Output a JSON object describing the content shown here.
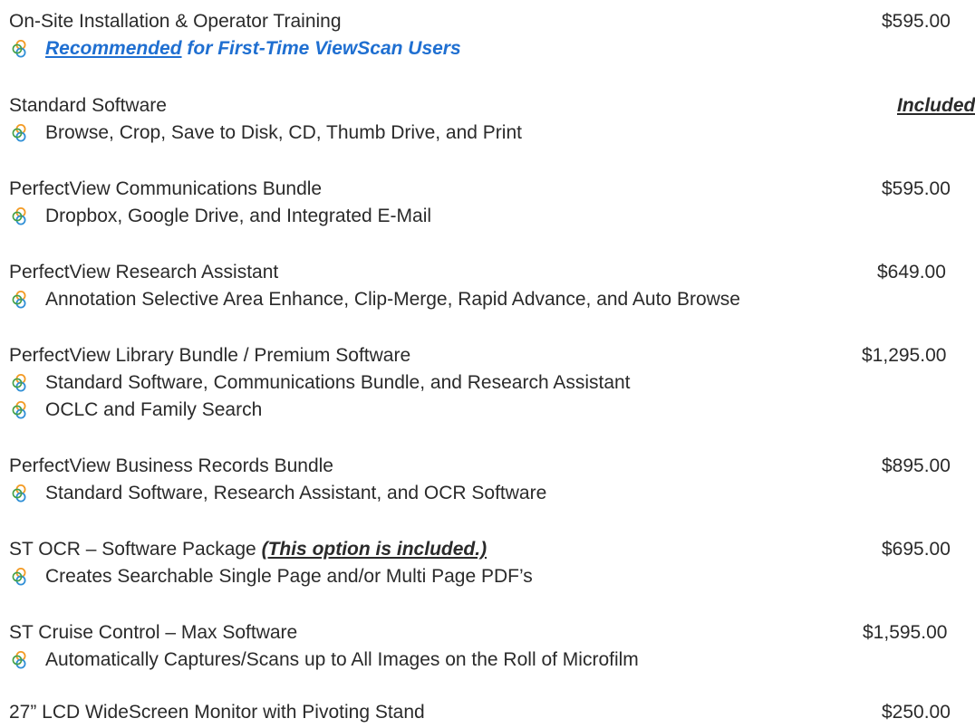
{
  "items": [
    {
      "name": "On-Site Installation & Operator Training",
      "price": "$595.00",
      "bullets": [
        {
          "lead": "Recommended",
          "rest": " for First-Time ViewScan Users"
        }
      ]
    },
    {
      "name": "Standard Software",
      "price": "Included",
      "bullets": [
        "Browse, Crop, Save to Disk, CD, Thumb Drive, and Print"
      ]
    },
    {
      "name": "PerfectView Communications Bundle",
      "price": "$595.00",
      "bullets": [
        "Dropbox, Google Drive, and Integrated E-Mail"
      ]
    },
    {
      "name": "PerfectView Research Assistant",
      "price": "$649.00",
      "bullets": [
        "Annotation Selective Area Enhance, Clip-Merge, Rapid Advance, and Auto Browse"
      ]
    },
    {
      "name": "PerfectView Library Bundle / Premium Software",
      "price": "$1,295.00",
      "bullets": [
        "Standard Software, Communications Bundle, and Research Assistant",
        "OCLC and Family Search"
      ]
    },
    {
      "name": "PerfectView Business Records Bundle",
      "price": "$895.00",
      "bullets": [
        "Standard Software, Research Assistant, and OCR Software"
      ]
    },
    {
      "name": "ST OCR – Software Package ",
      "name_note": "(This option is included.)",
      "price": "$695.00",
      "bullets": [
        "Creates Searchable Single Page and/or Multi Page PDF’s"
      ]
    },
    {
      "name": "ST Cruise Control – Max Software",
      "price": "$1,595.00",
      "bullets": [
        "Automatically Captures/Scans up to All Images on the Roll of Microfilm"
      ]
    },
    {
      "name": "27” LCD WideScreen Monitor with Pivoting Stand",
      "price": "$250.00",
      "bullets": []
    }
  ],
  "icons": {
    "bullet": "interlocking-rings-icon"
  },
  "colors": {
    "text": "#2a2a2a",
    "accent": "#1f6fd1",
    "bullet_orange": "#f39a22",
    "bullet_blue": "#2f8fd6",
    "bullet_green": "#43a047"
  }
}
